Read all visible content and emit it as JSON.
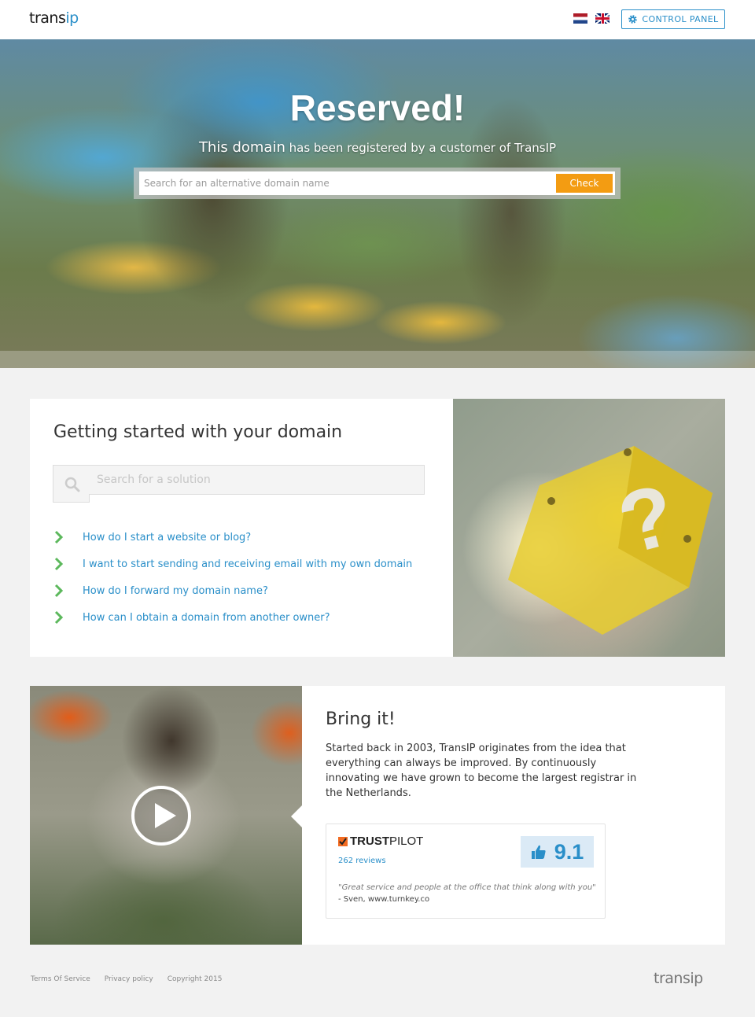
{
  "header": {
    "logo": {
      "part1": "trans",
      "part2": "ip"
    },
    "languages": [
      {
        "code": "nl",
        "icon": "flag-netherlands-icon"
      },
      {
        "code": "en",
        "icon": "flag-uk-icon"
      }
    ],
    "control_panel_label": "CONTROL PANEL",
    "control_panel_icon": "gear-icon"
  },
  "hero": {
    "title": "Reserved!",
    "subtitle_big": "This domain",
    "subtitle_rest": " has been registered by a customer of TransIP",
    "search_placeholder": "Search for an alternative domain name",
    "check_label": "Check",
    "check_color": "#f39c12"
  },
  "getting_started": {
    "title": "Getting started with your domain",
    "search_placeholder": "Search for a solution",
    "links": [
      {
        "label": "How do I start a website or blog?"
      },
      {
        "label": "I want to start sending and receiving email with my own domain"
      },
      {
        "label": "How do I forward my domain name?"
      },
      {
        "label": "How can I obtain a domain from another owner?"
      }
    ],
    "link_color": "#2a8fc9",
    "chevron_color": "#5cb85c"
  },
  "bring_it": {
    "title": "Bring it!",
    "text": "Started back in 2003, TransIP originates from the idea that everything can always be improved. By continuously innovating we have grown to become the largest registrar in the Netherlands.",
    "trustpilot": {
      "logo_bold": "TRUST",
      "logo_rest": "PILOT",
      "reviews": "262 reviews",
      "score": "9.1",
      "quote": "\"Great service and people at the office that think along with you\"",
      "author": "- Sven, www.turnkey.co"
    }
  },
  "footer": {
    "links": [
      "Terms Of Service",
      "Privacy policy"
    ],
    "copyright": "Copyright 2015",
    "logo": {
      "part1": "trans",
      "part2": "ip"
    }
  }
}
